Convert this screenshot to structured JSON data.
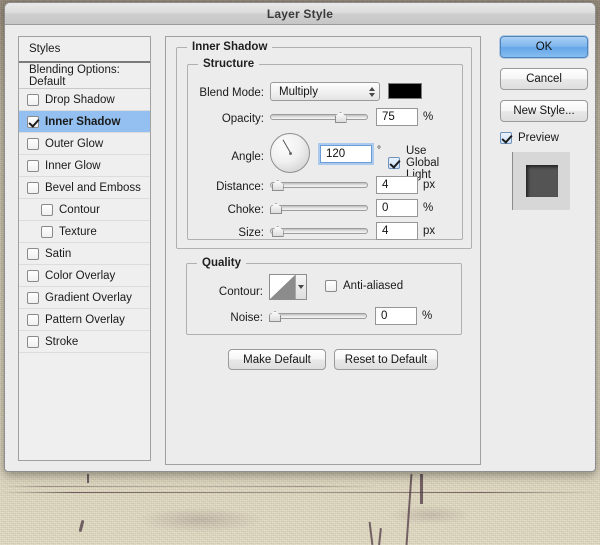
{
  "window": {
    "title": "Layer Style"
  },
  "sidebar": {
    "styles_header": "Styles",
    "blending_options": "Blending Options: Default",
    "items": [
      {
        "label": "Drop Shadow",
        "checked": false,
        "selected": false,
        "indented": false
      },
      {
        "label": "Inner Shadow",
        "checked": true,
        "selected": true,
        "indented": false
      },
      {
        "label": "Outer Glow",
        "checked": false,
        "selected": false,
        "indented": false
      },
      {
        "label": "Inner Glow",
        "checked": false,
        "selected": false,
        "indented": false
      },
      {
        "label": "Bevel and Emboss",
        "checked": false,
        "selected": false,
        "indented": false
      },
      {
        "label": "Contour",
        "checked": false,
        "selected": false,
        "indented": true
      },
      {
        "label": "Texture",
        "checked": false,
        "selected": false,
        "indented": true
      },
      {
        "label": "Satin",
        "checked": false,
        "selected": false,
        "indented": false
      },
      {
        "label": "Color Overlay",
        "checked": false,
        "selected": false,
        "indented": false
      },
      {
        "label": "Gradient Overlay",
        "checked": false,
        "selected": false,
        "indented": false
      },
      {
        "label": "Pattern Overlay",
        "checked": false,
        "selected": false,
        "indented": false
      },
      {
        "label": "Stroke",
        "checked": false,
        "selected": false,
        "indented": false
      }
    ]
  },
  "main": {
    "section_title": "Inner Shadow",
    "structure": {
      "legend": "Structure",
      "blend_mode_label": "Blend Mode:",
      "blend_mode_value": "Multiply",
      "blend_color": "#000000",
      "opacity_label": "Opacity:",
      "opacity_value": "75",
      "opacity_unit": "%",
      "opacity_percent": 75,
      "angle_label": "Angle:",
      "angle_value": "120",
      "angle_unit": "°",
      "use_global_light_label": "Use Global Light",
      "use_global_light_checked": true,
      "distance_label": "Distance:",
      "distance_value": "4",
      "distance_unit": "px",
      "distance_percent": 2,
      "choke_label": "Choke:",
      "choke_value": "0",
      "choke_unit": "%",
      "choke_percent": 0,
      "size_label": "Size:",
      "size_value": "4",
      "size_unit": "px",
      "size_percent": 2
    },
    "quality": {
      "legend": "Quality",
      "contour_label": "Contour:",
      "anti_aliased_label": "Anti-aliased",
      "anti_aliased_checked": false,
      "noise_label": "Noise:",
      "noise_value": "0",
      "noise_unit": "%",
      "noise_percent": 0
    },
    "buttons": {
      "make_default": "Make Default",
      "reset_to_default": "Reset to Default"
    }
  },
  "actions": {
    "ok": "OK",
    "cancel": "Cancel",
    "new_style": "New Style...",
    "preview_label": "Preview",
    "preview_checked": true
  },
  "colors": {
    "selection_blue": "#93c0f0",
    "primary_button": "#7fb6ee",
    "dialog_bg": "#ececec",
    "desktop": "#d4cdb4"
  }
}
